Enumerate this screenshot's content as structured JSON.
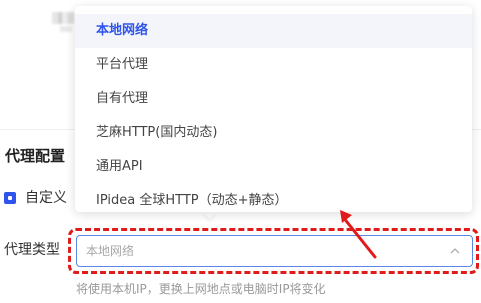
{
  "section": {
    "title": "代理配置",
    "checkbox_label": "自定义",
    "proxy_type_label": "代理类型"
  },
  "select": {
    "current_value": "本地网络",
    "hint": "将使用本机IP，更换上网地点或电脑时IP将变化"
  },
  "dropdown": {
    "options": [
      {
        "label": "本地网络",
        "selected": true
      },
      {
        "label": "平台代理",
        "selected": false
      },
      {
        "label": "自有代理",
        "selected": false
      },
      {
        "label": "芝麻HTTP(国内动态)",
        "selected": false
      },
      {
        "label": "通用API",
        "selected": false
      },
      {
        "label": "IPidea 全球HTTP（动态+静态）",
        "selected": false
      }
    ]
  },
  "colors": {
    "accent": "#2f54eb",
    "annotation_red": "#e01b1b",
    "input_border": "#5b86e5"
  },
  "icons": {
    "chevron": "chevron-up-icon",
    "checkbox": "checkbox-checked-icon"
  }
}
